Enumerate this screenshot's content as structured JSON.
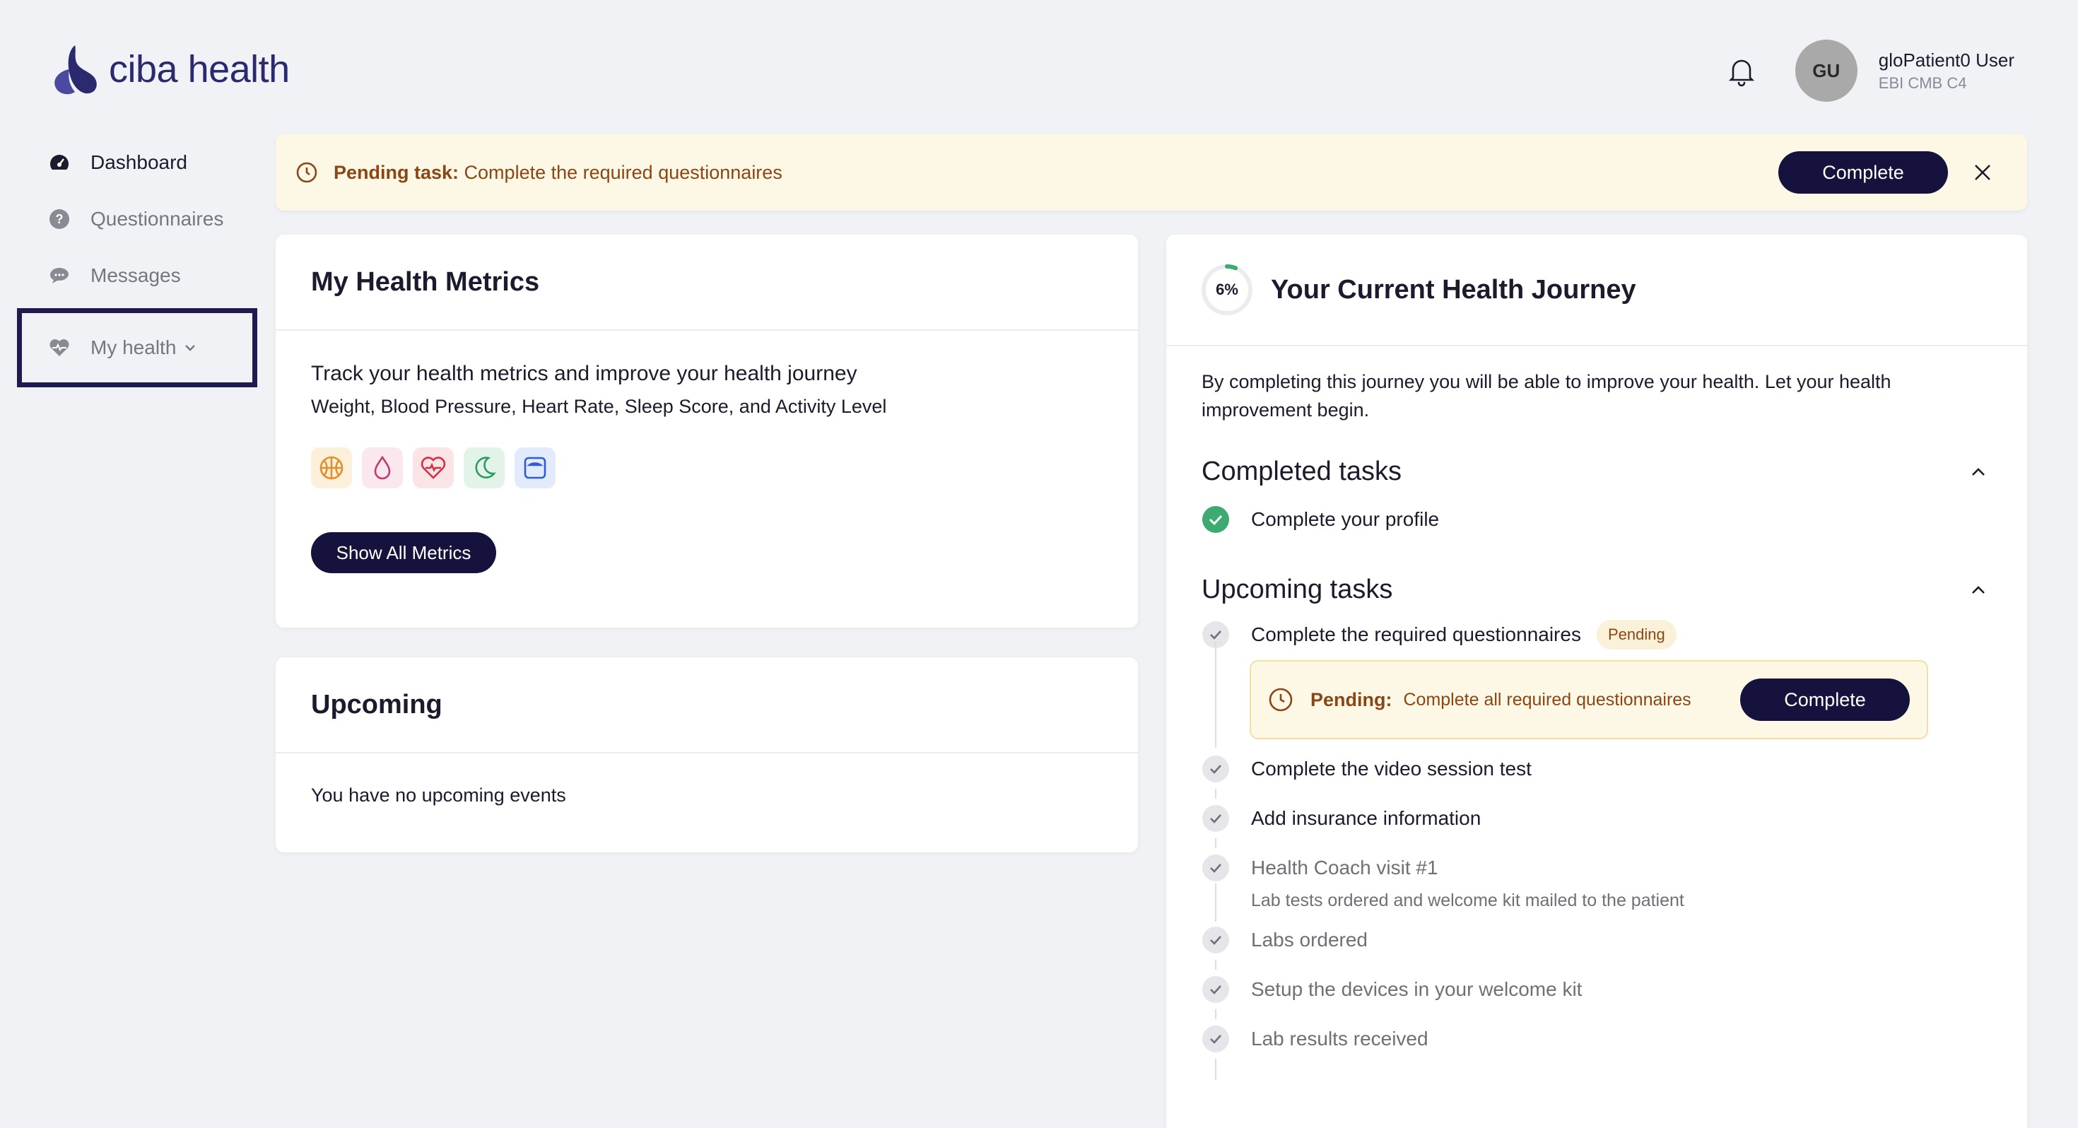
{
  "brand": {
    "name": "ciba health"
  },
  "user": {
    "initials": "GU",
    "name": "gloPatient0 User",
    "subtitle": "EBI CMB C4"
  },
  "sidebar": {
    "items": [
      {
        "label": "Dashboard",
        "icon": "gauge-icon"
      },
      {
        "label": "Questionnaires",
        "icon": "question-circle-icon"
      },
      {
        "label": "Messages",
        "icon": "chat-bubble-icon"
      },
      {
        "label": "My health",
        "icon": "heart-pulse-icon"
      }
    ]
  },
  "banner": {
    "label": "Pending task:",
    "text": "Complete the required questionnaires",
    "button": "Complete"
  },
  "metrics": {
    "title": "My Health Metrics",
    "heading": "Track your health metrics and improve your health journey",
    "subheading": "Weight, Blood Pressure, Heart Rate, Sleep Score, and Activity Level",
    "icons": [
      "activity-ball-icon",
      "blood-drop-icon",
      "heart-rate-icon",
      "moon-sleep-icon",
      "scale-icon"
    ],
    "button": "Show All Metrics"
  },
  "upcoming": {
    "title": "Upcoming",
    "empty_text": "You have no upcoming events"
  },
  "journey": {
    "progress": "6%",
    "progress_value": 0.06,
    "title": "Your Current Health Journey",
    "intro": "By completing this journey you will be able to improve your health. Let your health improvement begin.",
    "completed_title": "Completed tasks",
    "completed": [
      "Complete your profile"
    ],
    "upcoming_title": "Upcoming tasks",
    "upcoming_tasks": [
      {
        "label": "Complete the required questionnaires",
        "badge": "Pending"
      },
      {
        "label": "Complete the video session test"
      },
      {
        "label": "Add insurance information"
      },
      {
        "label": "Health Coach visit #1",
        "sub": "Lab tests ordered and welcome kit mailed to the patient"
      },
      {
        "label": "Labs ordered"
      },
      {
        "label": "Setup the devices in your welcome kit"
      },
      {
        "label": "Lab results received"
      }
    ],
    "pending_box": {
      "label": "Pending:",
      "text": "Complete all required questionnaires",
      "button": "Complete"
    }
  },
  "colors": {
    "primary_dark": "#15133d",
    "brand_purple": "#2b2a6e",
    "pending_bg": "#fdf8e6",
    "pending_text": "#8a4614",
    "success_green": "#3daa6f"
  }
}
